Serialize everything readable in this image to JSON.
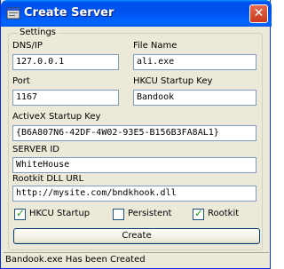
{
  "window": {
    "title": "Create Server",
    "close_glyph": "✕",
    "title_icon": "app-window-icon"
  },
  "settings": {
    "group_label": "Settings",
    "dns_ip": {
      "label": "DNS/IP",
      "value": "127.0.0.1"
    },
    "file_name": {
      "label": "File Name",
      "value": "ali.exe"
    },
    "port": {
      "label": "Port",
      "value": "1167"
    },
    "hkcu_key": {
      "label": "HKCU Startup Key",
      "value": "Bandook"
    },
    "activex_key": {
      "label": "ActiveX Startup Key",
      "value": "{B6A807N6-42DF-4W02-93E5-B156B3FA8AL1}"
    },
    "server_id": {
      "label": "SERVER ID",
      "value": "WhiteHouse"
    },
    "rootkit_url": {
      "label": "Rootkit DLL URL",
      "value": "http://mysite.com/bndkhook.dll"
    }
  },
  "options": [
    {
      "label": "HKCU Startup",
      "checked": true
    },
    {
      "label": "Persistent",
      "checked": false
    },
    {
      "label": "Rootkit",
      "checked": true
    }
  ],
  "create_button": {
    "label": "Create"
  },
  "status": {
    "text": "Bandook.exe Has been Created"
  },
  "colors": {
    "titlebar": "#0054e3",
    "face": "#ece9d8",
    "field_border": "#7f9db9",
    "check": "#21a121"
  }
}
